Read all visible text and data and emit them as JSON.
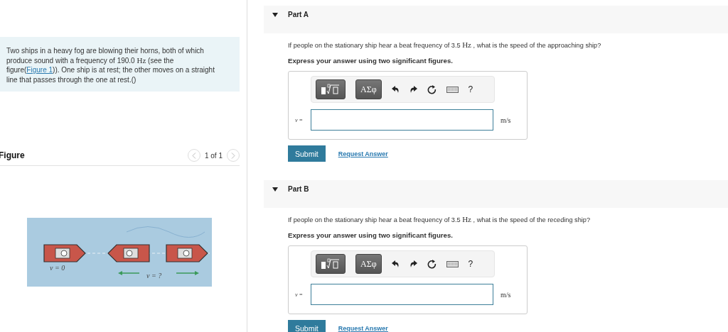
{
  "problem": [
    {
      "kind": "text",
      "text": "Two ships in a heavy fog are blowing their horns, both of which produce sound with a frequency of 190.0 "
    },
    {
      "kind": "math",
      "text": "Hz"
    },
    {
      "kind": "text",
      "text": " (see the figure("
    },
    {
      "kind": "link",
      "text": "Figure 1"
    },
    {
      "kind": "text",
      "text": ")). One ship is at rest; the other moves on a straight line that passes through the one at rest.()"
    }
  ],
  "figure": {
    "title": "Figure",
    "pager": "1 of 1",
    "prev_disabled": true,
    "next_disabled": true,
    "labels": [
      "v = 0",
      "v = ?"
    ]
  },
  "parts": [
    {
      "title": "Part A",
      "expanded": true,
      "question": [
        {
          "kind": "text",
          "text": "If people on the stationary ship hear a beat frequency of 3.5 "
        },
        {
          "kind": "math",
          "text": "Hz"
        },
        {
          "kind": "text",
          "text": " , what is the speed of the approaching ship?"
        }
      ],
      "instruction": "Express your answer using two significant figures.",
      "toolbar": {
        "greek": "ΑΣφ",
        "help": "?"
      },
      "variable": "v =",
      "unit": "m/s",
      "submit": "Submit",
      "request": "Request Answer"
    },
    {
      "title": "Part B",
      "expanded": true,
      "question": [
        {
          "kind": "text",
          "text": "If people on the stationary ship hear a beat frequency of 3.5 "
        },
        {
          "kind": "math",
          "text": "Hz"
        },
        {
          "kind": "text",
          "text": " , what is the speed of the receding ship?"
        }
      ],
      "instruction": "Express your answer using two significant figures.",
      "toolbar": {
        "greek": "ΑΣφ",
        "help": "?"
      },
      "variable": "v =",
      "unit": "m/s",
      "submit": "Submit",
      "request": "Request Answer"
    }
  ]
}
